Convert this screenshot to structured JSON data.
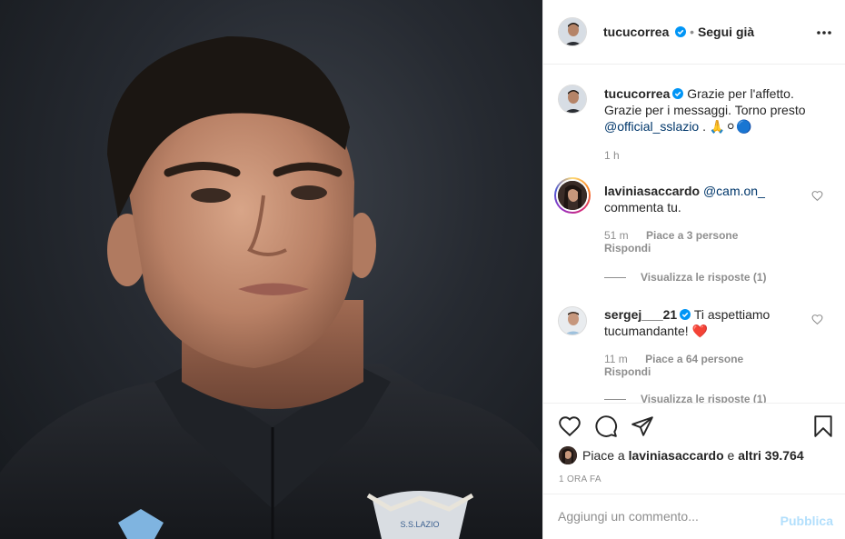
{
  "post": {
    "author": "tucucorrea",
    "follow_status": "Segui già",
    "separator": "•"
  },
  "caption": {
    "username": "tucucorrea",
    "text": "Grazie per l'affetto. Grazie per i messaggi. Torno presto",
    "mention": "@official_sslazio",
    "after_mention": " . 🙏⚪🔵",
    "time": "1 h"
  },
  "comments": [
    {
      "username": "laviniasaccardo",
      "mention": "@cam.on_",
      "text": "commenta tu.",
      "time": "51 m",
      "likes": "Piace a 3 persone",
      "reply": "Rispondi",
      "view_replies": "Visualizza le risposte (1)"
    },
    {
      "username": "sergej___21",
      "text": "Ti aspettiamo tucumandante!",
      "emoji": "❤️",
      "time": "11 m",
      "likes": "Piace a 64 persone",
      "reply": "Rispondi",
      "view_replies": "Visualizza le risposte (1)"
    }
  ],
  "likes": {
    "prefix": "Piace a",
    "user": "laviniasaccardo",
    "middle": "e",
    "others": "altri 39.764"
  },
  "timestamp": "1 ORA FA",
  "add_comment": {
    "placeholder": "Aggiungi un commento...",
    "publish": "Pubblica"
  },
  "photo": {
    "badge_text": "S.S.LAZIO"
  },
  "colors": {
    "text": "#262626",
    "muted": "#8e8e8e",
    "link": "#00376b",
    "verified": "#0095f6",
    "publish_disabled": "#b2dffc",
    "heart": "#ed4956"
  }
}
